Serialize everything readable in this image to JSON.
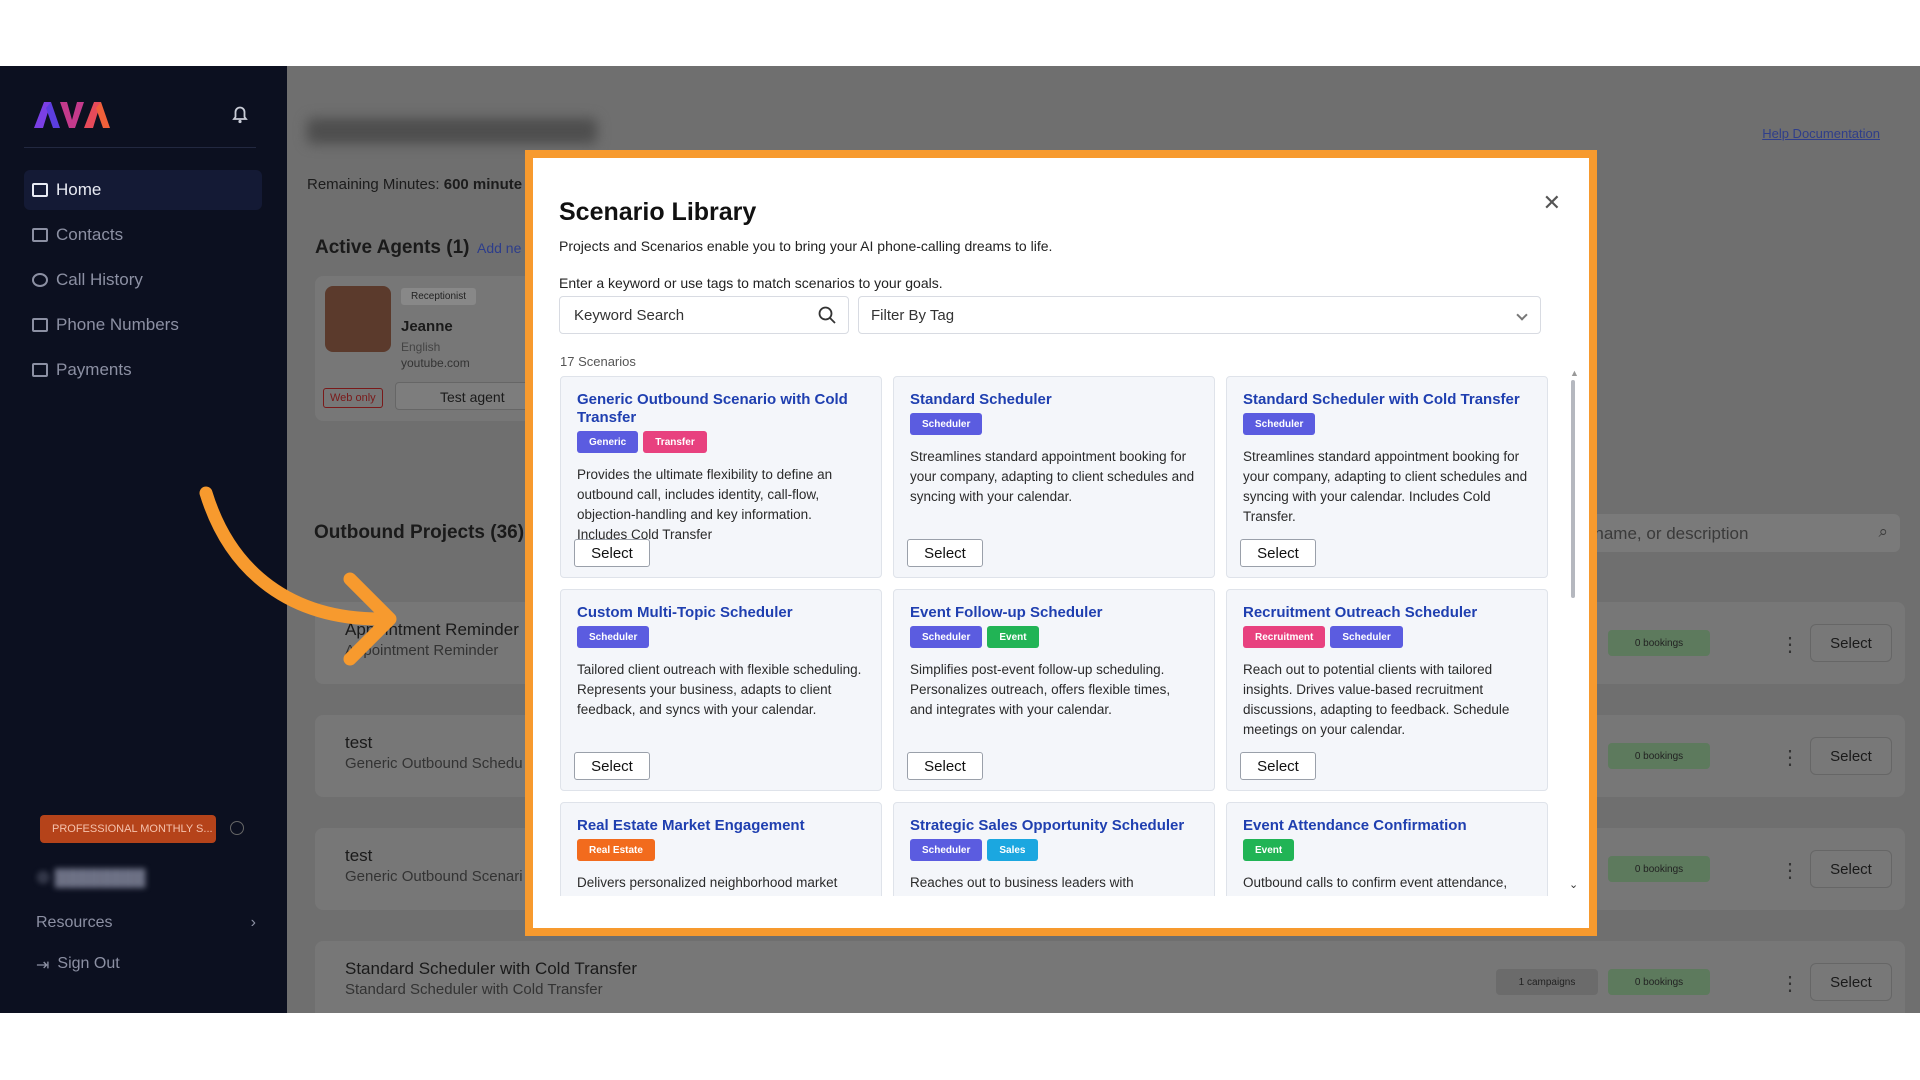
{
  "sidebar": {
    "logo": "AVA",
    "nav": [
      {
        "label": "Home",
        "icon": "folder-icon",
        "active": true
      },
      {
        "label": "Contacts",
        "icon": "contacts-icon"
      },
      {
        "label": "Call History",
        "icon": "history-icon"
      },
      {
        "label": "Phone Numbers",
        "icon": "phone-icon"
      },
      {
        "label": "Payments",
        "icon": "card-icon"
      }
    ],
    "plan": "PROFESSIONAL MONTHLY S...",
    "resources": "Resources",
    "sign_out": "Sign Out"
  },
  "main": {
    "help_link": "Help Documentation",
    "remaining_label": "Remaining Minutes:",
    "remaining_value": "600 minute",
    "active_agents": "Active Agents (1)",
    "add_new": "Add ne",
    "agent": {
      "role": "Receptionist",
      "name": "Jeanne",
      "language": "English",
      "site": "youtube.com",
      "web_only": "Web only",
      "test_button": "Test agent"
    },
    "outbound_title": "Outbound Projects (36)",
    "search_placeholder": "ect name, or description",
    "projects": [
      {
        "name": "Appointment Reminder",
        "sub": "Appointment Reminder",
        "bookings": "0 bookings",
        "campaigns": ""
      },
      {
        "name": "test",
        "sub": "Generic Outbound Schedu",
        "bookings": "0 bookings",
        "campaigns": ""
      },
      {
        "name": "test",
        "sub": "Generic Outbound Scenari",
        "bookings": "0 bookings",
        "campaigns": ""
      },
      {
        "name": "Standard Scheduler with Cold Transfer",
        "sub": "Standard Scheduler with Cold Transfer",
        "bookings": "0 bookings",
        "campaigns": "1 campaigns"
      }
    ],
    "select_label": "Select"
  },
  "modal": {
    "title": "Scenario Library",
    "subtitle": "Projects and Scenarios enable you to bring your AI phone-calling dreams to life.",
    "hint": "Enter a keyword or use tags to match scenarios to your goals.",
    "keyword_placeholder": "Keyword Search",
    "tag_filter": "Filter By Tag",
    "count": "17 Scenarios",
    "select_label": "Select",
    "cards": [
      {
        "title": "Generic Outbound Scenario with Cold Transfer",
        "tags": [
          {
            "label": "Generic",
            "color": "#5b5ce0"
          },
          {
            "label": "Transfer",
            "color": "#e8417f"
          }
        ],
        "desc": "Provides the ultimate flexibility to define an outbound call, includes identity, call-flow, objection-handling and key information. Includes Cold Transfer"
      },
      {
        "title": "Standard Scheduler",
        "tags": [
          {
            "label": "Scheduler",
            "color": "#5b5ce0"
          }
        ],
        "desc": "Streamlines standard appointment booking for your company, adapting to client schedules and syncing with your calendar."
      },
      {
        "title": "Standard Scheduler with Cold Transfer",
        "tags": [
          {
            "label": "Scheduler",
            "color": "#5b5ce0"
          }
        ],
        "desc": "Streamlines standard appointment booking for your company, adapting to client schedules and syncing with your calendar. Includes Cold Transfer."
      },
      {
        "title": "Custom Multi-Topic Scheduler",
        "tags": [
          {
            "label": "Scheduler",
            "color": "#5b5ce0"
          }
        ],
        "desc": "Tailored client outreach with flexible scheduling. Represents your business, adapts to client feedback, and syncs with your calendar."
      },
      {
        "title": "Event Follow-up Scheduler",
        "tags": [
          {
            "label": "Scheduler",
            "color": "#5b5ce0"
          },
          {
            "label": "Event",
            "color": "#21b455"
          }
        ],
        "desc": "Simplifies post-event follow-up scheduling. Personalizes outreach, offers flexible times, and integrates with your calendar."
      },
      {
        "title": "Recruitment Outreach Scheduler",
        "tags": [
          {
            "label": "Recruitment",
            "color": "#e8417f"
          },
          {
            "label": "Scheduler",
            "color": "#5b5ce0"
          }
        ],
        "desc": "Reach out to potential clients with tailored insights. Drives value-based recruitment discussions, adapting to feedback. Schedule meetings on your calendar."
      },
      {
        "title": "Real Estate Market Engagement",
        "tags": [
          {
            "label": "Real Estate",
            "color": "#f26b1d"
          }
        ],
        "desc": "Delivers personalized neighborhood market"
      },
      {
        "title": "Strategic Sales Opportunity Scheduler",
        "tags": [
          {
            "label": "Scheduler",
            "color": "#5b5ce0"
          },
          {
            "label": "Sales",
            "color": "#1ba7e0"
          }
        ],
        "desc": "Reaches out to business leaders with"
      },
      {
        "title": "Event Attendance Confirmation",
        "tags": [
          {
            "label": "Event",
            "color": "#21b455"
          }
        ],
        "desc": "Outbound calls to confirm event attendance,"
      }
    ]
  }
}
